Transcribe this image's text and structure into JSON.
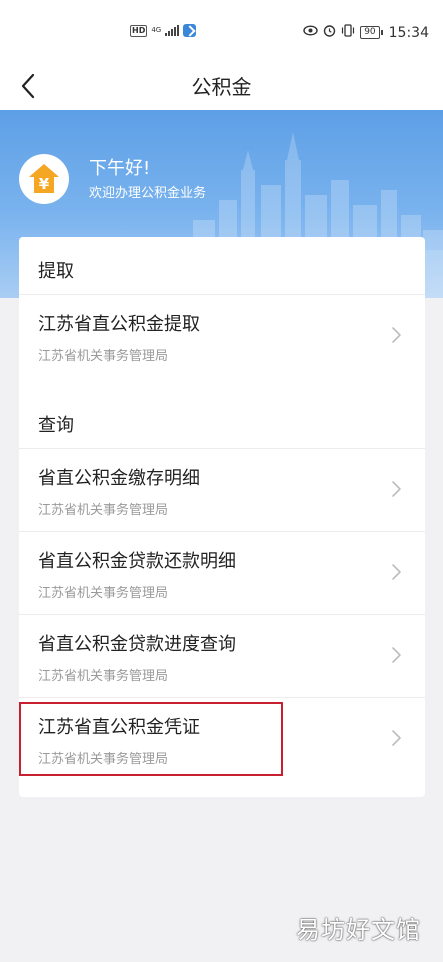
{
  "status_bar": {
    "hd": "HD",
    "network": "4G",
    "battery": "90",
    "time": "15:34"
  },
  "nav": {
    "title": "公积金"
  },
  "banner": {
    "greeting": "下午好!",
    "welcome": "欢迎办理公积金业务",
    "logo_symbol": "¥"
  },
  "sections": {
    "withdraw_title": "提取",
    "query_title": "查询"
  },
  "items": [
    {
      "title": "江苏省直公积金提取",
      "subtitle": "江苏省机关事务管理局"
    },
    {
      "title": "省直公积金缴存明细",
      "subtitle": "江苏省机关事务管理局"
    },
    {
      "title": "省直公积金贷款还款明细",
      "subtitle": "江苏省机关事务管理局"
    },
    {
      "title": "省直公积金贷款进度查询",
      "subtitle": "江苏省机关事务管理局"
    },
    {
      "title": "江苏省直公积金凭证",
      "subtitle": "江苏省机关事务管理局"
    }
  ],
  "watermark": "易坊好文馆",
  "colors": {
    "banner": "#6aa7ea",
    "highlight": "#c8202e",
    "logo": "#f5a623"
  }
}
